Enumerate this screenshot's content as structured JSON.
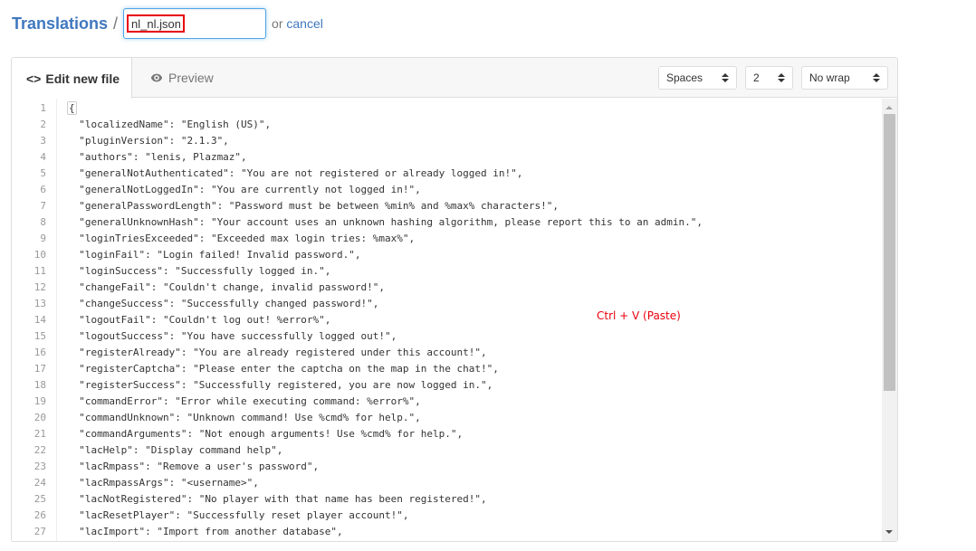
{
  "header": {
    "breadcrumb_root": "Translations",
    "separator": "/",
    "filename_value": "nl_nl.json",
    "or_text": "or",
    "cancel_label": "cancel"
  },
  "editor": {
    "tabs": [
      {
        "label": "Edit new file",
        "icon": "code-icon",
        "active": true
      },
      {
        "label": "Preview",
        "icon": "eye-icon",
        "active": false
      }
    ],
    "indent_mode": {
      "selected": "Spaces"
    },
    "indent_size": {
      "selected": "2"
    },
    "wrap_mode": {
      "selected": "No wrap"
    },
    "scroll_position_fraction": 0.0,
    "lines": [
      {
        "n": "1",
        "text": "{"
      },
      {
        "n": "2",
        "text": "  \"localizedName\": \"English (US)\","
      },
      {
        "n": "3",
        "text": "  \"pluginVersion\": \"2.1.3\","
      },
      {
        "n": "4",
        "text": "  \"authors\": \"lenis, Plazmaz\","
      },
      {
        "n": "5",
        "text": "  \"generalNotAuthenticated\": \"You are not registered or already logged in!\","
      },
      {
        "n": "6",
        "text": "  \"generalNotLoggedIn\": \"You are currently not logged in!\","
      },
      {
        "n": "7",
        "text": "  \"generalPasswordLength\": \"Password must be between %min% and %max% characters!\","
      },
      {
        "n": "8",
        "text": "  \"generalUnknownHash\": \"Your account uses an unknown hashing algorithm, please report this to an admin.\","
      },
      {
        "n": "9",
        "text": "  \"loginTriesExceeded\": \"Exceeded max login tries: %max%\","
      },
      {
        "n": "10",
        "text": "  \"loginFail\": \"Login failed! Invalid password.\","
      },
      {
        "n": "11",
        "text": "  \"loginSuccess\": \"Successfully logged in.\","
      },
      {
        "n": "12",
        "text": "  \"changeFail\": \"Couldn't change, invalid password!\","
      },
      {
        "n": "13",
        "text": "  \"changeSuccess\": \"Successfully changed password!\","
      },
      {
        "n": "14",
        "text": "  \"logoutFail\": \"Couldn't log out! %error%\","
      },
      {
        "n": "15",
        "text": "  \"logoutSuccess\": \"You have successfully logged out!\","
      },
      {
        "n": "16",
        "text": "  \"registerAlready\": \"You are already registered under this account!\","
      },
      {
        "n": "17",
        "text": "  \"registerCaptcha\": \"Please enter the captcha on the map in the chat!\","
      },
      {
        "n": "18",
        "text": "  \"registerSuccess\": \"Successfully registered, you are now logged in.\","
      },
      {
        "n": "19",
        "text": "  \"commandError\": \"Error while executing command: %error%\","
      },
      {
        "n": "20",
        "text": "  \"commandUnknown\": \"Unknown command! Use %cmd% for help.\","
      },
      {
        "n": "21",
        "text": "  \"commandArguments\": \"Not enough arguments! Use %cmd% for help.\","
      },
      {
        "n": "22",
        "text": "  \"lacHelp\": \"Display command help\","
      },
      {
        "n": "23",
        "text": "  \"lacRmpass\": \"Remove a user's password\","
      },
      {
        "n": "24",
        "text": "  \"lacRmpassArgs\": \"<username>\","
      },
      {
        "n": "25",
        "text": "  \"lacNotRegistered\": \"No player with that name has been registered!\","
      },
      {
        "n": "26",
        "text": "  \"lacResetPlayer\": \"Successfully reset player account!\","
      },
      {
        "n": "27",
        "text": "  \"lacImport\": \"Import from another database\","
      }
    ]
  },
  "annotation": {
    "text": "Ctrl + V (Paste)",
    "color": "#e8000b"
  },
  "colors": {
    "link": "#4078c0",
    "highlight_box": "#e8000b",
    "focus_border": "#51a7e8"
  }
}
